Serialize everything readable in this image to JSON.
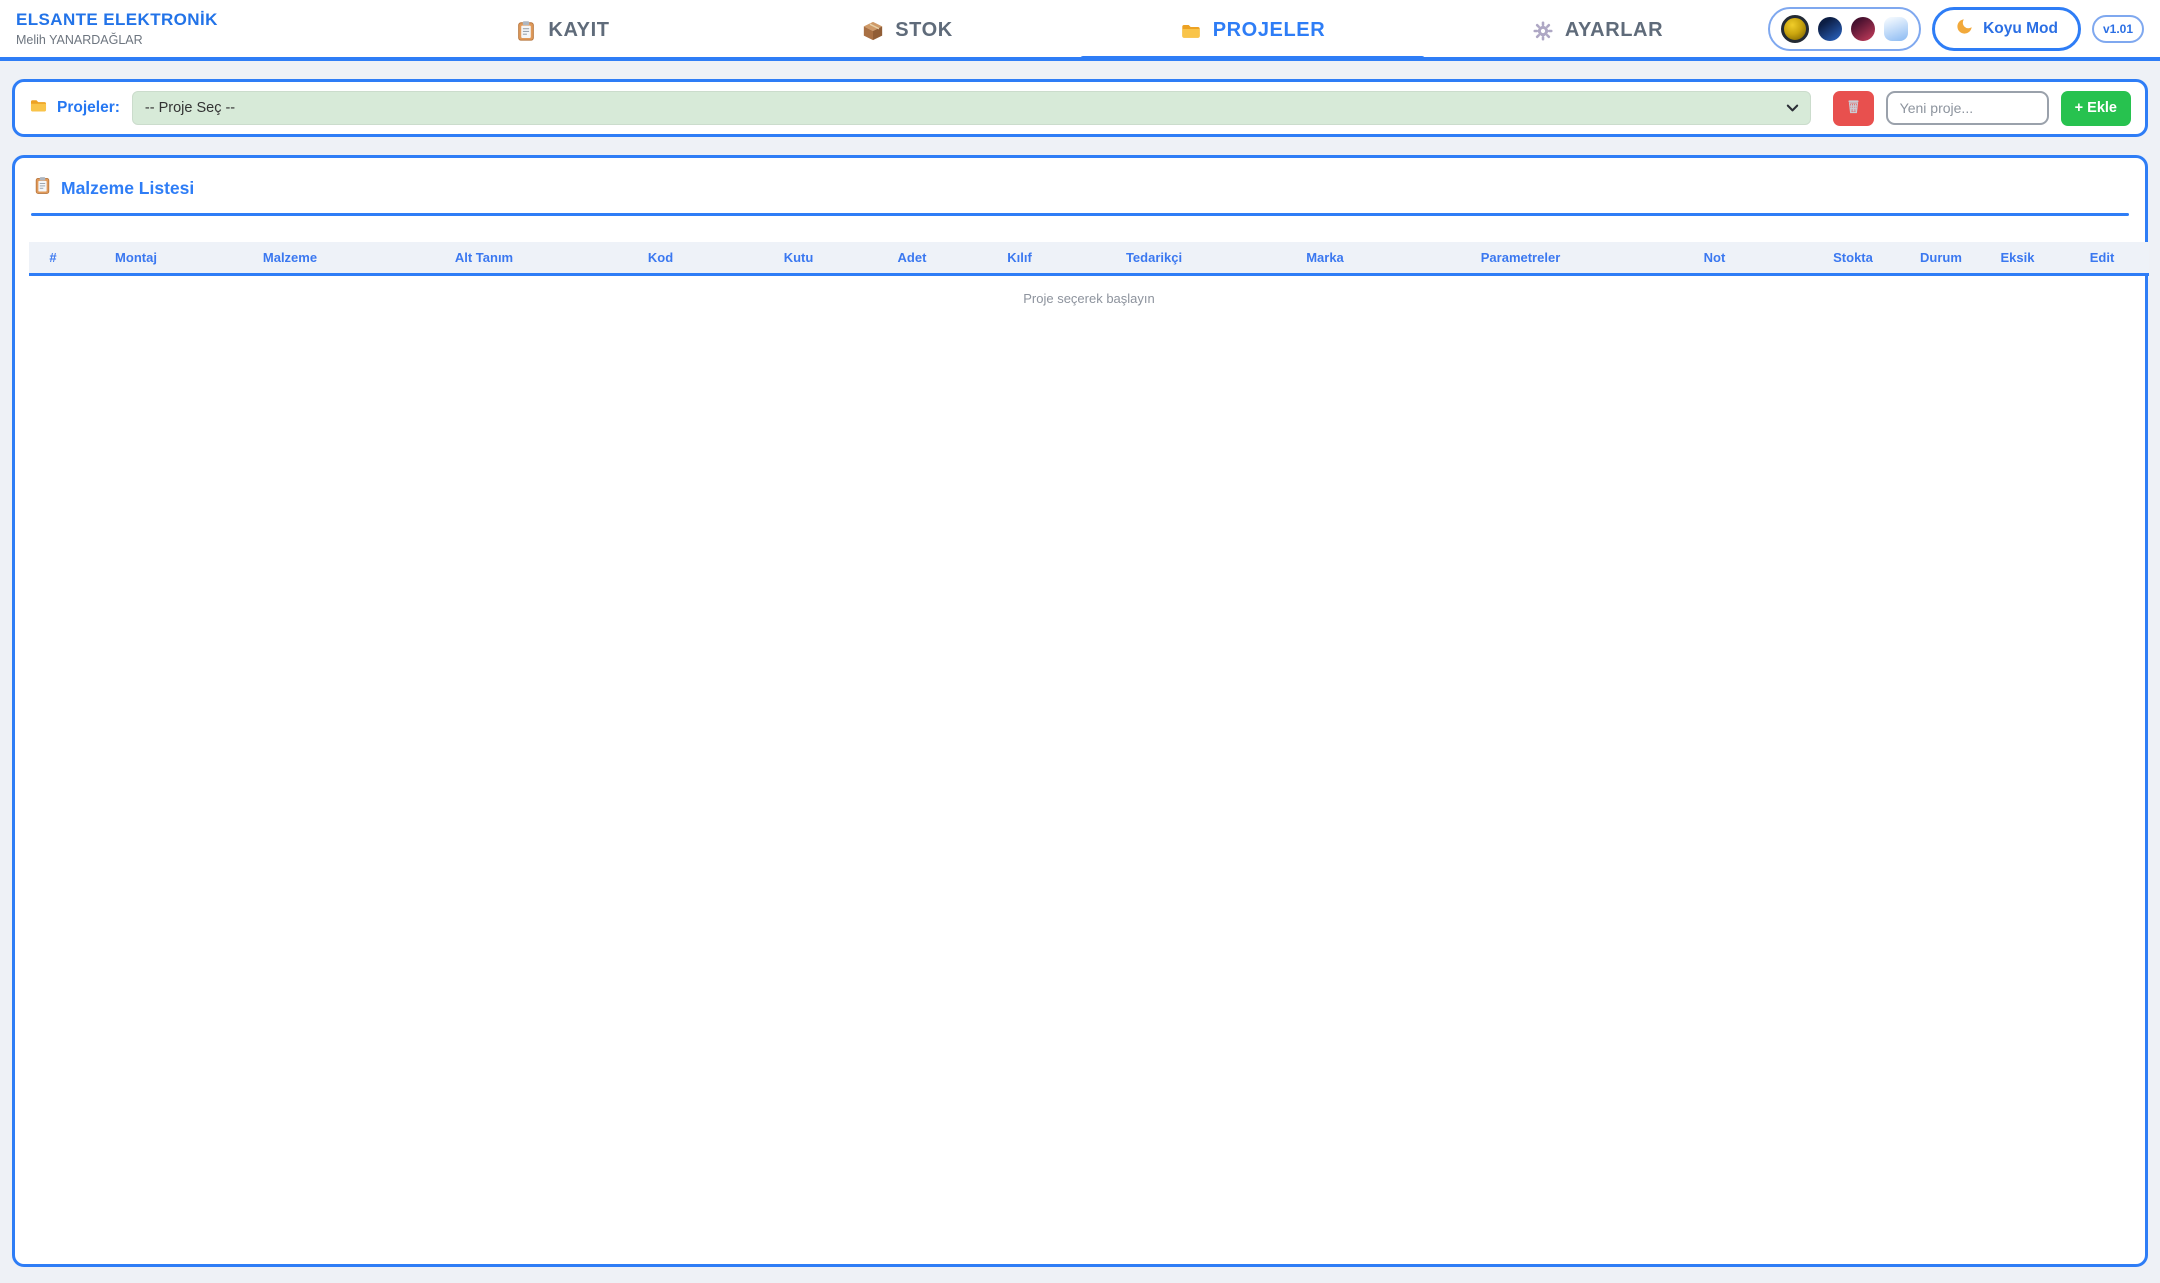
{
  "brand": {
    "title": "ELSANTE ELEKTRONİK",
    "subtitle": "Melih YANARDAĞLAR"
  },
  "nav": {
    "tabs": [
      {
        "label": "KAYIT",
        "icon": "clipboard-icon",
        "active": false
      },
      {
        "label": "STOK",
        "icon": "package-icon",
        "active": false
      },
      {
        "label": "PROJELER",
        "icon": "folder-icon",
        "active": true
      },
      {
        "label": "AYARLAR",
        "icon": "gear-icon",
        "active": false
      }
    ]
  },
  "header_right": {
    "theme_swatches": [
      {
        "name": "gold",
        "selected": true,
        "gradient": "radial-gradient(circle at 38% 32%, #f0cd2a 0%, #caa50e 45%, #6e5800 100%)"
      },
      {
        "name": "navy",
        "selected": false,
        "gradient": "linear-gradient(145deg, #0c1e45 25%, #2a63c0 95%)"
      },
      {
        "name": "crimson",
        "selected": false,
        "gradient": "linear-gradient(145deg, #45102e 20%, #c23b5a 95%)"
      },
      {
        "name": "light-blue",
        "selected": false,
        "gradient": "linear-gradient(160deg, #f0f7fe 10%, #90bdf3 95%)"
      }
    ],
    "dark_mode_label": "Koyu Mod",
    "version": "v1.01"
  },
  "toolbar": {
    "label": "Projeler:",
    "select_value": "-- Proje Seç --",
    "new_project_placeholder": "Yeni proje...",
    "add_button_label": "+ Ekle"
  },
  "main": {
    "title": "Malzeme Listesi",
    "table": {
      "columns": [
        "#",
        "Montaj",
        "Malzeme",
        "Alt Tanım",
        "Kod",
        "Kutu",
        "Adet",
        "Kılıf",
        "Tedarikçi",
        "Marka",
        "Parametreler",
        "Not",
        "Stokta",
        "Durum",
        "Eksik",
        "Edit"
      ],
      "empty_message": "Proje seçerek başlayın"
    }
  },
  "colors": {
    "primary_blue": "#2e7df6",
    "brand_blue": "#2273e8",
    "select_green_bg": "#d7ead8",
    "danger_red": "#e8504e",
    "success_green": "#27c24f",
    "table_header_bg": "#eef2f8",
    "page_bg": "#eef1f6"
  }
}
